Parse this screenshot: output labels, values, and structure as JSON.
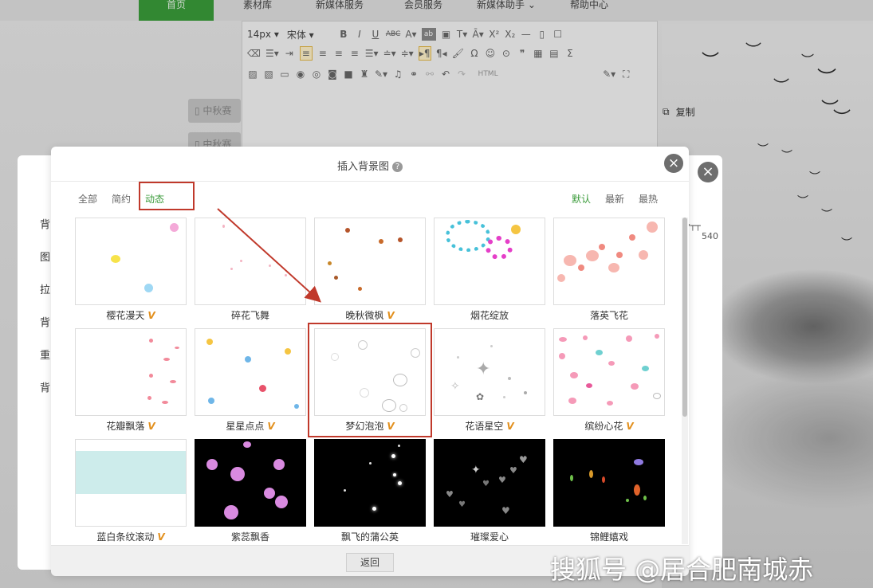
{
  "nav": {
    "items": [
      "首页",
      "素材库",
      "新媒体服务",
      "会员服务",
      "新媒体助手 ⌄",
      "帮助中心"
    ]
  },
  "editor": {
    "font_size": "14px",
    "font_family": "宋体",
    "html_label": "HTML"
  },
  "page": {
    "copy_label": "复制",
    "side_buttons": [
      "中秋赛",
      "中秋赛"
    ]
  },
  "back_dialog": {
    "labels": [
      "背",
      "图",
      "拉",
      "背",
      "重",
      "背"
    ],
    "ruler_value": "540",
    "close_glyph": "×"
  },
  "modal": {
    "title": "插入背景图",
    "help_glyph": "?",
    "close_glyph": "×",
    "tabs": [
      {
        "label": "全部"
      },
      {
        "label": "简约"
      },
      {
        "label": "动态"
      }
    ],
    "active_tab": "动态",
    "sorts": [
      {
        "label": "默认"
      },
      {
        "label": "最新"
      },
      {
        "label": "最热"
      }
    ],
    "active_sort": "默认",
    "vip_badge": "V",
    "items": [
      {
        "name": "樱花漫天",
        "vip": true
      },
      {
        "name": "碎花飞舞",
        "vip": false
      },
      {
        "name": "晚秋微枫",
        "vip": true
      },
      {
        "name": "烟花绽放",
        "vip": false
      },
      {
        "name": "落英飞花",
        "vip": false
      },
      {
        "name": "花瓣飘落",
        "vip": true
      },
      {
        "name": "星星点点",
        "vip": true
      },
      {
        "name": "梦幻泡泡",
        "vip": true
      },
      {
        "name": "花语星空",
        "vip": true
      },
      {
        "name": "缤纷心花",
        "vip": true
      },
      {
        "name": "蓝白条纹滚动",
        "vip": true
      },
      {
        "name": "紫蕊飘香",
        "vip": false
      },
      {
        "name": "飘飞的蒲公英",
        "vip": false
      },
      {
        "name": "璀璨爱心",
        "vip": false
      },
      {
        "name": "锦鲤嬉戏",
        "vip": false
      }
    ],
    "return_label": "返回"
  },
  "watermark": "搜狐号 @居合肥南城赤",
  "colors": {
    "accent": "#3a9b3a",
    "highlight": "#c0392b",
    "vip": "#e2901e"
  }
}
